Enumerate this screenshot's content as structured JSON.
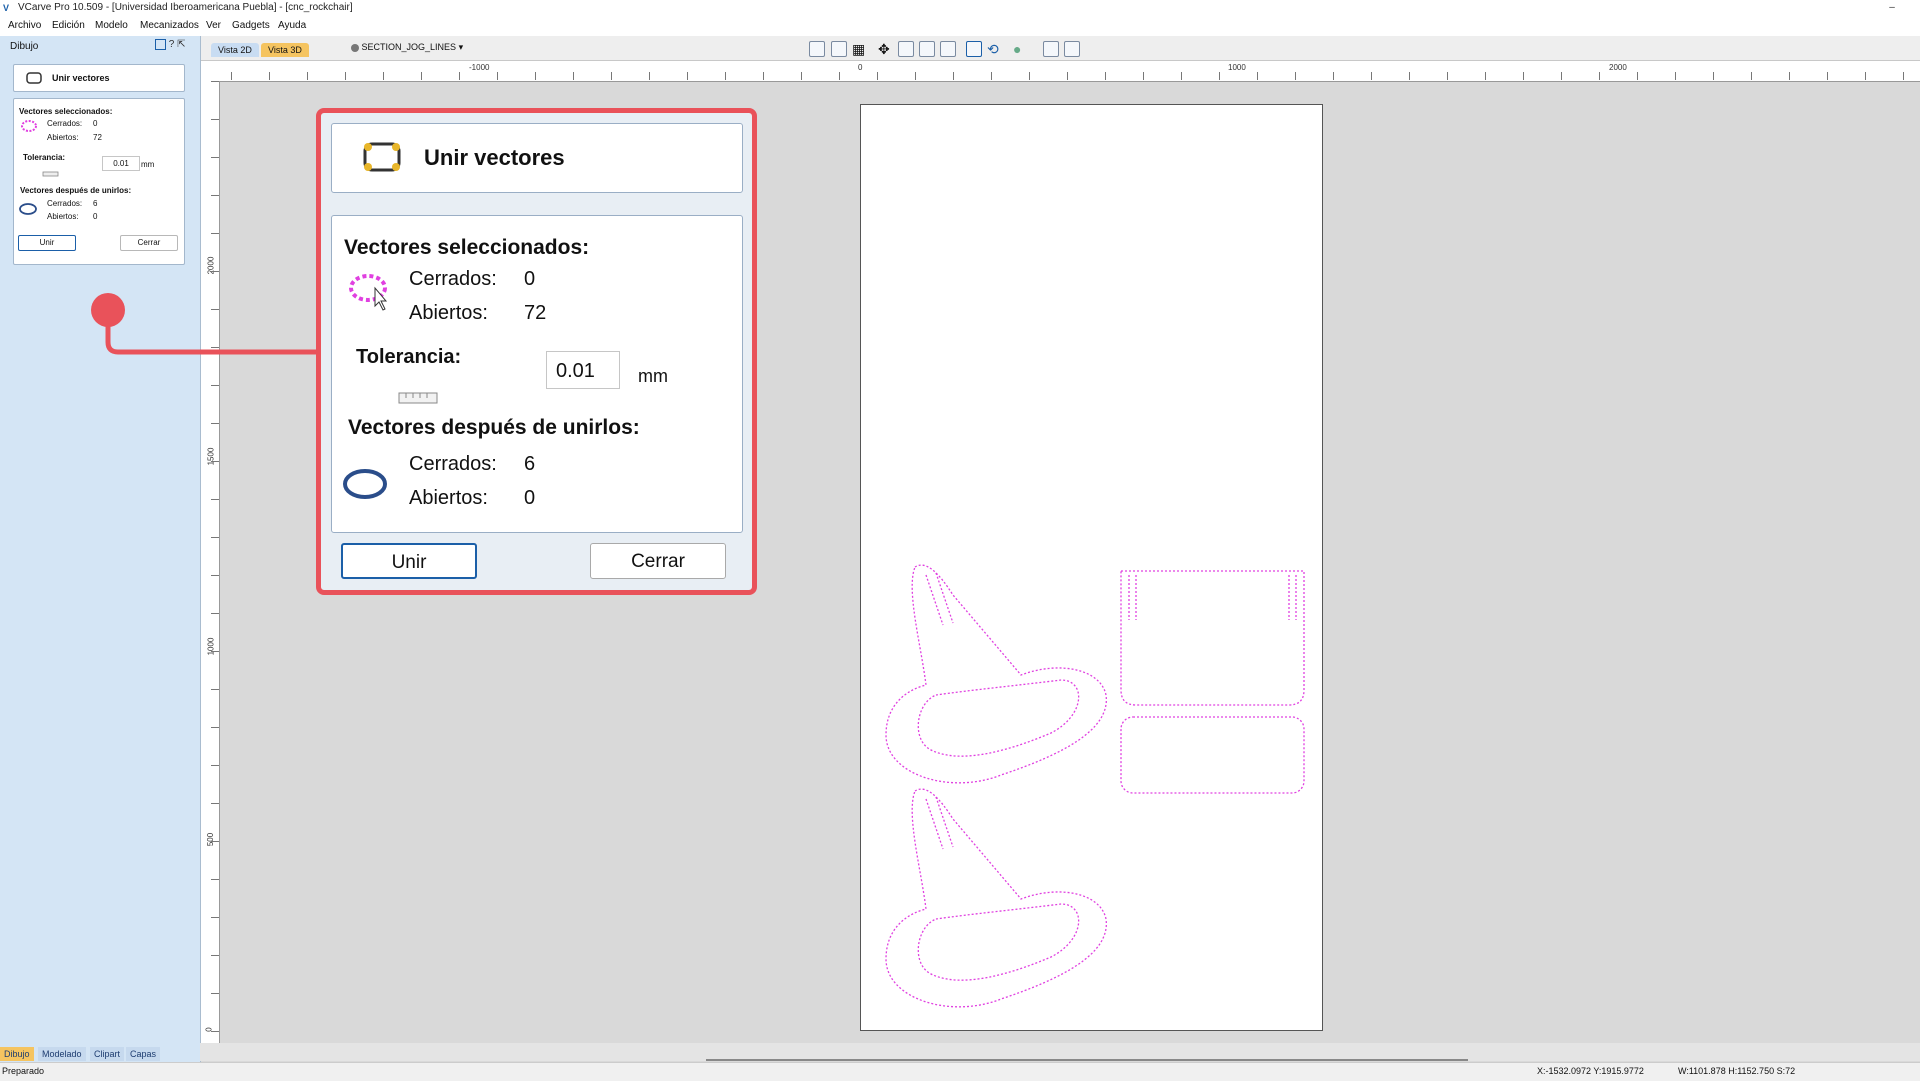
{
  "app": {
    "title": "VCarve Pro 10.509 - [Universidad Iberoamericana Puebla] - [cnc_rockchair]",
    "minimize_symbol": "–"
  },
  "menu": [
    "Archivo",
    "Edición",
    "Modelo",
    "Mecanizados",
    "Ver",
    "Gadgets",
    "Ayuda"
  ],
  "panel": {
    "header": "Dibujo",
    "header_icons": "? ⇱",
    "tool_title": "Unir vectores",
    "selected_heading": "Vectores seleccionados:",
    "closed_label": "Cerrados:",
    "closed_value": "0",
    "open_label": "Abiertos:",
    "open_value": "72",
    "tolerance_label": "Tolerancia:",
    "tolerance_value": "0.01",
    "tolerance_unit": "mm",
    "after_heading": "Vectores después de unirlos:",
    "after_closed_label": "Cerrados:",
    "after_closed_value": "6",
    "after_open_label": "Abiertos:",
    "after_open_value": "0",
    "join_button": "Unir",
    "close_button": "Cerrar"
  },
  "bottom_tabs": [
    "Dibujo",
    "Modelado",
    "Clipart",
    "Capas"
  ],
  "view_tabs": [
    "Vista 2D",
    "Vista 3D"
  ],
  "layer_selector": "SECTION_JOG_LINES",
  "ruler_top_labels": [
    "-1000",
    "0",
    "1000",
    "2000"
  ],
  "ruler_left_labels": [
    "2000",
    "1500",
    "1000",
    "500",
    "0"
  ],
  "callout": {
    "tool_title": "Unir vectores",
    "selected_heading": "Vectores seleccionados:",
    "closed_label": "Cerrados:",
    "closed_value": "0",
    "open_label": "Abiertos:",
    "open_value": "72",
    "tolerance_label": "Tolerancia:",
    "tolerance_value": "0.01",
    "tolerance_unit": "mm",
    "after_heading": "Vectores después de unirlos:",
    "after_closed_label": "Cerrados:",
    "after_closed_value": "6",
    "after_open_label": "Abiertos:",
    "after_open_value": "0",
    "join_button": "Unir",
    "close_button": "Cerrar",
    "border_color": "#e9525a"
  },
  "status": {
    "left": "Preparado",
    "coords": "X:-1532.0972 Y:1915.9772",
    "size": "W:1101.878  H:1152.750  S:72"
  },
  "colors": {
    "panel_bg": "#d4e5f5",
    "vector_color": "#e040e0",
    "accent": "#1b5fa8"
  },
  "icons": {
    "selected_vectors": "dashed-ellipse-icon",
    "joined_vectors": "closed-ellipse-icon",
    "tool": "join-vectors-icon"
  }
}
